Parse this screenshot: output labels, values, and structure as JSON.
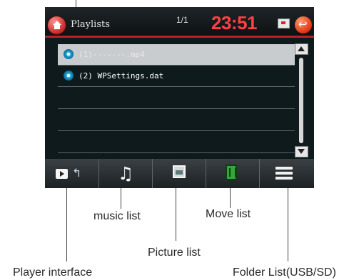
{
  "header": {
    "title": "Playlists",
    "page_count": "1/1",
    "clock": "23:51",
    "home_icon": "home-icon",
    "screen_icon": "screen-toggle-icon",
    "back_icon": "back-icon"
  },
  "list": {
    "items": [
      {
        "label": "(1)-------.mp4",
        "selected": true
      },
      {
        "label": "(2) WPSettings.dat",
        "selected": false
      },
      {
        "label": "",
        "selected": false
      },
      {
        "label": "",
        "selected": false
      },
      {
        "label": "",
        "selected": false
      }
    ]
  },
  "toolbar": {
    "buttons": [
      {
        "name": "player-interface-button",
        "icon": "player-interface-icon"
      },
      {
        "name": "music-list-button",
        "icon": "music-note-icon"
      },
      {
        "name": "picture-list-button",
        "icon": "picture-icon"
      },
      {
        "name": "movie-list-button",
        "icon": "film-icon"
      },
      {
        "name": "folder-list-button",
        "icon": "list-icon"
      }
    ]
  },
  "annotations": {
    "music_list": "music list",
    "move_list": "Move list",
    "picture_list": "Picture list",
    "player_interface": "Player interface",
    "folder_list": "Folder List(USB/SD)"
  },
  "colors": {
    "clock": "#ff4040",
    "accent_line": "#b5222a",
    "selected_row": "#c9ccce",
    "movie_icon": "#31a83a"
  }
}
